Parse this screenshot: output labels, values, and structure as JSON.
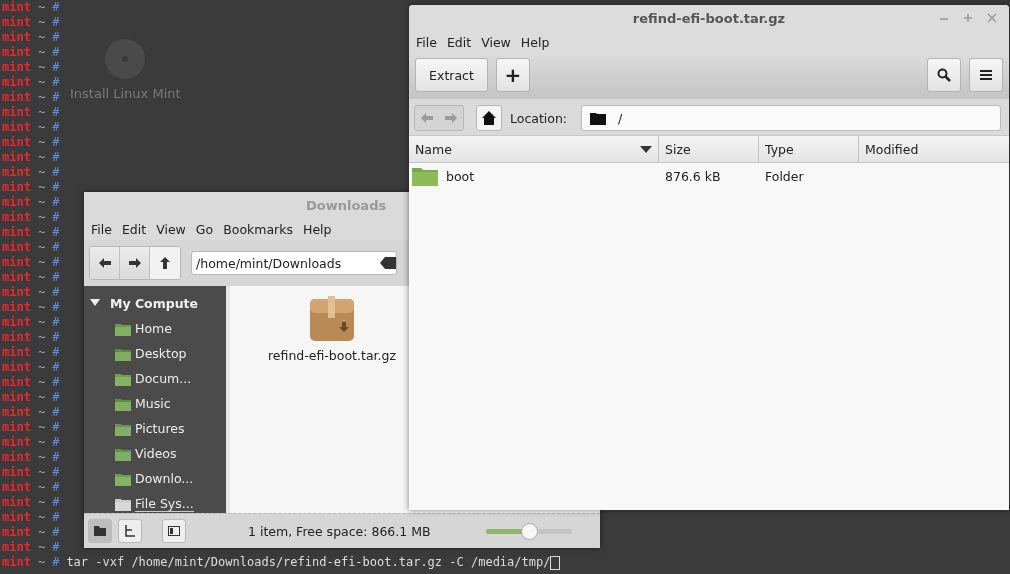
{
  "desktop": {
    "icon_label": "Install Linux Mint"
  },
  "terminal": {
    "lines": [
      {
        "user": "mint",
        "path": "~",
        "sign": "#"
      },
      {
        "user": "mint",
        "path": "~",
        "sign": "#"
      },
      {
        "user": "mint",
        "path": "~",
        "sign": "#"
      },
      {
        "user": "mint",
        "path": "~",
        "sign": "#"
      },
      {
        "user": "mint",
        "path": "~",
        "sign": "#"
      },
      {
        "user": "mint",
        "path": "~",
        "sign": "#"
      },
      {
        "user": "mint",
        "path": "~",
        "sign": "#"
      },
      {
        "user": "mint",
        "path": "~",
        "sign": "#"
      },
      {
        "user": "mint",
        "path": "~",
        "sign": "#"
      },
      {
        "user": "mint",
        "path": "~",
        "sign": "#"
      },
      {
        "user": "mint",
        "path": "~",
        "sign": "#"
      },
      {
        "user": "mint",
        "path": "~",
        "sign": "#"
      },
      {
        "user": "mint",
        "path": "~",
        "sign": "#"
      },
      {
        "user": "mint",
        "path": "~",
        "sign": "#"
      },
      {
        "user": "mint",
        "path": "~",
        "sign": "#"
      },
      {
        "user": "mint",
        "path": "~",
        "sign": "#"
      },
      {
        "user": "mint",
        "path": "~",
        "sign": "#"
      },
      {
        "user": "mint",
        "path": "~",
        "sign": "#"
      },
      {
        "user": "mint",
        "path": "~",
        "sign": "#"
      },
      {
        "user": "mint",
        "path": "~",
        "sign": "#"
      },
      {
        "user": "mint",
        "path": "~",
        "sign": "#"
      },
      {
        "user": "mint",
        "path": "~",
        "sign": "#"
      },
      {
        "user": "mint",
        "path": "~",
        "sign": "#"
      },
      {
        "user": "mint",
        "path": "~",
        "sign": "#"
      },
      {
        "user": "mint",
        "path": "~",
        "sign": "#"
      },
      {
        "user": "mint",
        "path": "~",
        "sign": "#"
      },
      {
        "user": "mint",
        "path": "~",
        "sign": "#"
      },
      {
        "user": "mint",
        "path": "~",
        "sign": "#"
      },
      {
        "user": "mint",
        "path": "~",
        "sign": "#"
      },
      {
        "user": "mint",
        "path": "~",
        "sign": "#"
      },
      {
        "user": "mint",
        "path": "~",
        "sign": "#"
      },
      {
        "user": "mint",
        "path": "~",
        "sign": "#"
      },
      {
        "user": "mint",
        "path": "~",
        "sign": "#"
      },
      {
        "user": "mint",
        "path": "~",
        "sign": "#"
      },
      {
        "user": "mint",
        "path": "~",
        "sign": "#"
      },
      {
        "user": "mint",
        "path": "~",
        "sign": "#"
      },
      {
        "user": "mint",
        "path": "~",
        "sign": "#"
      },
      {
        "user": "mint",
        "path": "~",
        "sign": "#",
        "command": "tar -vxf /home/mint/Downloads/refind-efi-boot.tar.gz -C /media/tmp/"
      }
    ]
  },
  "file_manager": {
    "title": "Downloads",
    "menu": [
      "File",
      "Edit",
      "View",
      "Go",
      "Bookmarks",
      "Help"
    ],
    "location": {
      "value": "/home/mint/Downloads"
    },
    "sidebar": {
      "header": "My Compute",
      "expanded": true,
      "items": [
        {
          "label": "Home",
          "kind": "home"
        },
        {
          "label": "Desktop",
          "kind": "desktop"
        },
        {
          "label": "Docum...",
          "kind": "documents"
        },
        {
          "label": "Music",
          "kind": "music"
        },
        {
          "label": "Pictures",
          "kind": "pictures"
        },
        {
          "label": "Videos",
          "kind": "videos"
        },
        {
          "label": "Downlo...",
          "kind": "downloads"
        },
        {
          "label": "File Sys...",
          "kind": "drive"
        }
      ]
    },
    "files": [
      {
        "name": "refind-efi-boot.tar.gz"
      }
    ],
    "status_bar": {
      "text": "1 item, Free space: 866.1 MB",
      "zoom": {
        "level": 0.5
      }
    }
  },
  "archive_manager": {
    "title": "refind-efi-boot.tar.gz",
    "menu": [
      "File",
      "Edit",
      "View",
      "Help"
    ],
    "toolbar": {
      "extract": "Extract",
      "add": "+"
    },
    "navigation": {
      "back_disabled": true,
      "forward_disabled": true
    },
    "location": {
      "label": "Location:",
      "value": "/"
    },
    "table": {
      "columns": [
        {
          "label": "Name",
          "sorted": true
        },
        {
          "label": "Size",
          "sorted": false
        },
        {
          "label": "Type",
          "sorted": false
        },
        {
          "label": "Modified",
          "sorted": false
        }
      ],
      "rows": [
        {
          "name": "boot",
          "size": "876.6 kB",
          "type": "Folder"
        }
      ]
    }
  }
}
